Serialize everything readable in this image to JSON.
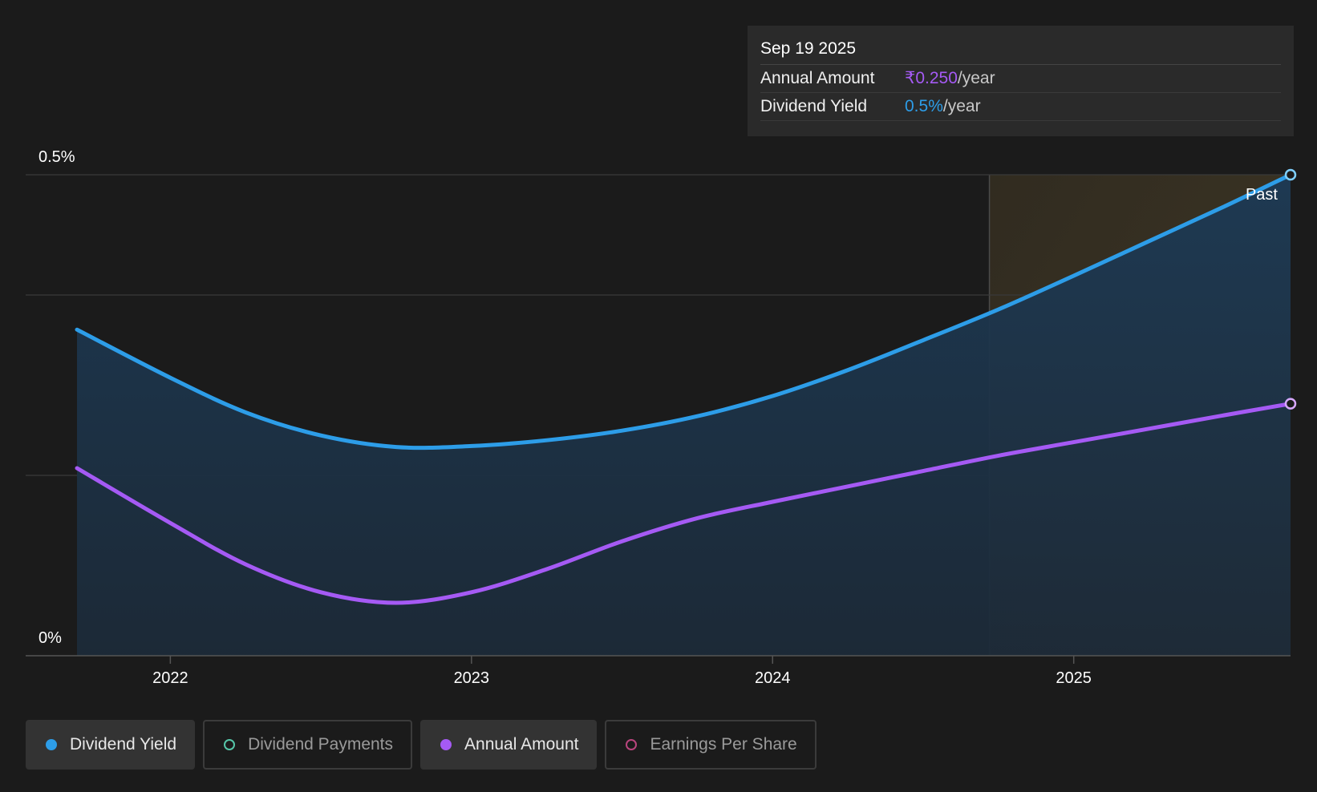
{
  "chart_data": {
    "type": "line",
    "y_tick_labels": [
      "0.5%",
      "0%"
    ],
    "ylim": [
      0,
      0.5
    ],
    "x_tick_labels": [
      "2022",
      "2023",
      "2024",
      "2025"
    ],
    "xlim": [
      2021.69,
      2025.72
    ],
    "past_label": "Past",
    "forecast_start_x": 2024.72,
    "grid": true,
    "series": [
      {
        "name": "Dividend Yield",
        "color": "#2d9de8",
        "fill": true,
        "x": [
          2021.69,
          2022.0,
          2022.25,
          2022.5,
          2022.75,
          2023.0,
          2023.25,
          2023.5,
          2023.75,
          2024.0,
          2024.25,
          2024.5,
          2024.75,
          2025.0,
          2025.25,
          2025.5,
          2025.72
        ],
        "y": [
          0.339,
          0.289,
          0.253,
          0.229,
          0.217,
          0.218,
          0.224,
          0.234,
          0.249,
          0.27,
          0.297,
          0.328,
          0.36,
          0.395,
          0.431,
          0.467,
          0.5
        ]
      },
      {
        "name": "Annual Amount",
        "color": "#a55af4",
        "fill": false,
        "x": [
          2021.69,
          2022.0,
          2022.25,
          2022.5,
          2022.75,
          2023.0,
          2023.25,
          2023.5,
          2023.75,
          2024.0,
          2024.25,
          2024.5,
          2024.75,
          2025.0,
          2025.25,
          2025.5,
          2025.72
        ],
        "y": [
          0.195,
          0.138,
          0.095,
          0.066,
          0.055,
          0.066,
          0.09,
          0.119,
          0.143,
          0.16,
          0.176,
          0.192,
          0.208,
          0.222,
          0.236,
          0.25,
          0.262
        ]
      }
    ]
  },
  "tooltip": {
    "date": "Sep 19 2025",
    "rows": [
      {
        "label": "Annual Amount",
        "value": "₹0.250",
        "suffix": "/year"
      },
      {
        "label": "Dividend Yield",
        "value": "0.5%",
        "suffix": "/year"
      }
    ]
  },
  "legend": [
    {
      "label": "Dividend Yield",
      "active": true,
      "color": "#2d9de8"
    },
    {
      "label": "Dividend Payments",
      "active": false,
      "color": "#56c6a9"
    },
    {
      "label": "Annual Amount",
      "active": true,
      "color": "#a55af4"
    },
    {
      "label": "Earnings Per Share",
      "active": false,
      "color": "#b9457d"
    }
  ]
}
